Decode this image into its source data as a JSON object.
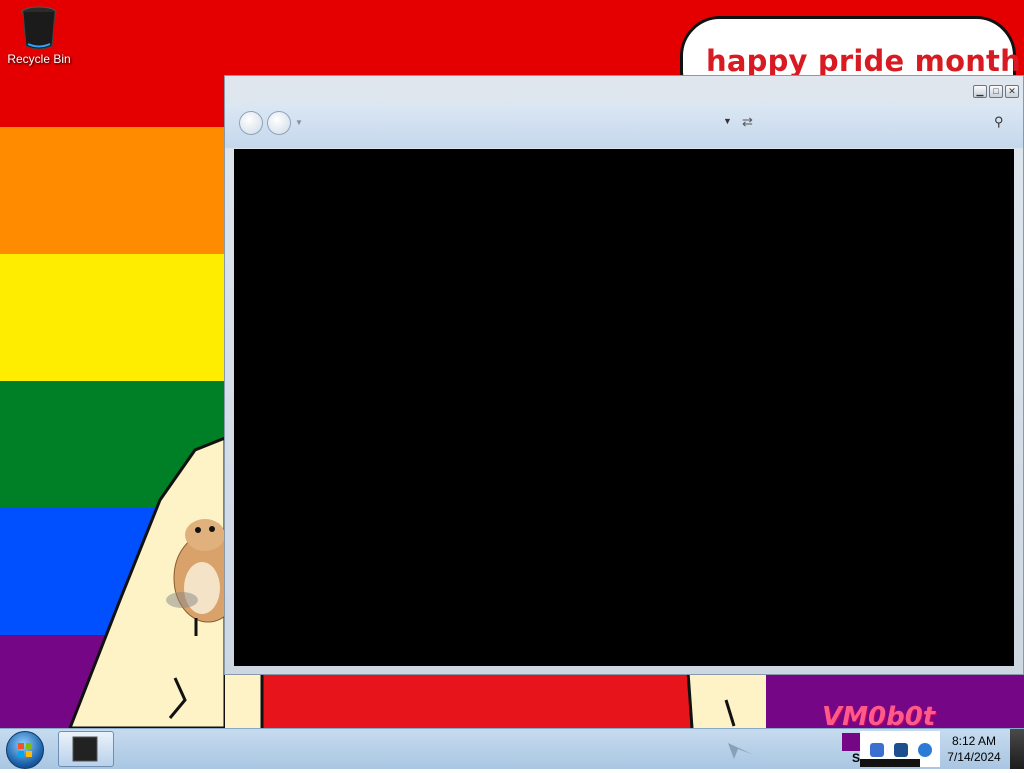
{
  "desktop": {
    "icons": [
      {
        "label": "Recycle Bin",
        "icon": "recycle-bin-icon"
      }
    ],
    "wallpaper": {
      "speech_text": "happy pride month",
      "logo_text": "VM0b0t",
      "stripe_colors": [
        "#e40000",
        "#ff8c00",
        "#ffed00",
        "#008026",
        "#0050ff",
        "#750787"
      ]
    }
  },
  "window": {
    "controls": [
      "minimize",
      "maximize",
      "close"
    ],
    "nav": {
      "back_icon": "back-arrow-icon",
      "forward_icon": "forward-arrow-icon",
      "refresh_icon": "refresh-icon",
      "search_icon": "search-icon"
    }
  },
  "taskbar": {
    "start_icon": "windows-orb-icon",
    "tray_label": "S",
    "clock": {
      "time": "8:12 AM",
      "date": "7/14/2024"
    }
  }
}
